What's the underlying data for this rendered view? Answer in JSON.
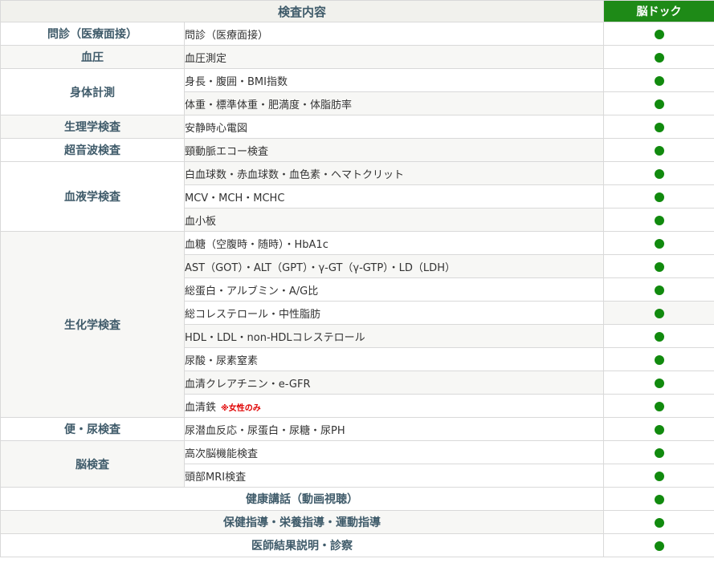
{
  "header": {
    "title": "検査内容",
    "course": "脳ドック"
  },
  "rows": [
    {
      "category": "問診（医療面接）",
      "item": "問診（医療面接）"
    },
    {
      "category": "血圧",
      "item": "血圧測定"
    },
    {
      "category": "身体計測",
      "items": [
        "身長・腹囲・BMI指数",
        "体重・標準体重・肥満度・体脂肪率"
      ]
    },
    {
      "category": "生理学検査",
      "item": "安静時心電図"
    },
    {
      "category": "超音波検査",
      "item": "頸動脈エコー検査"
    },
    {
      "category": "血液学検査",
      "items": [
        "白血球数・赤血球数・血色素・ヘマトクリット",
        "MCV・MCH・MCHC",
        "血小板"
      ]
    },
    {
      "category": "生化学検査",
      "items": [
        "血糖（空腹時・随時）・HbA1c",
        "AST（GOT）・ALT（GPT）・γ-GT（γ-GTP）・LD（LDH）",
        "総蛋白・アルブミン・A/G比",
        "総コレステロール・中性脂肪",
        "HDL・LDL・non-HDLコレステロール",
        "尿酸・尿素窒素",
        "血清クレアチニン・e-GFR",
        "血清鉄"
      ],
      "note": "※女性のみ"
    },
    {
      "category": "便・尿検査",
      "item": "尿潜血反応・尿蛋白・尿糖・尿PH"
    },
    {
      "category": "脳検査",
      "items": [
        "高次脳機能検査",
        "頭部MRI検査"
      ]
    },
    {
      "category": "健康講話（動画視聴）"
    },
    {
      "category": "保健指導・栄養指導・運動指導"
    },
    {
      "category": "医師結果説明・診察"
    }
  ]
}
